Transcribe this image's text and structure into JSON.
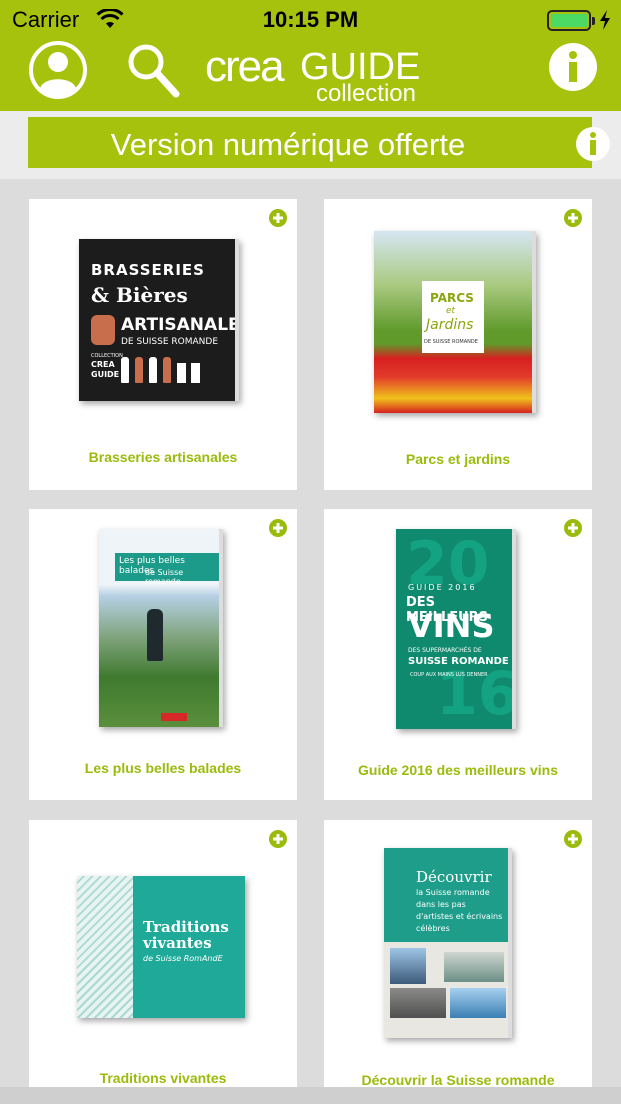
{
  "status_bar": {
    "carrier": "Carrier",
    "time": "10:15 PM"
  },
  "nav": {
    "logo_crea": "crea",
    "logo_guide": "GUIDE",
    "logo_collection": "collection",
    "icons": [
      "profile-icon",
      "search-icon",
      "info-icon"
    ]
  },
  "banner": {
    "text": "Version numérique offerte",
    "icon": "info-icon"
  },
  "colors": {
    "brand_green": "#a6c20c",
    "title_green": "#9bbb0c",
    "teal": "#0f8a6e"
  },
  "books": [
    {
      "title": "Brasseries artisanales",
      "cover": {
        "l1": "BRASSERIES",
        "l2": "& Bières",
        "l3": "ARTISANALES",
        "l4": "DE SUISSE ROMANDE",
        "l5": "COLLECTION",
        "l6": "CREA",
        "l7": "GUIDE"
      }
    },
    {
      "title": "Parcs et jardins",
      "cover": {
        "l1": "PARCS",
        "l2": "et",
        "l3": "Jardins",
        "l4": "DE SUISSE ROMANDE"
      }
    },
    {
      "title": "Les plus belles balades",
      "cover": {
        "l1": "Les plus belles balades",
        "l2": "de Suisse romande"
      }
    },
    {
      "title": "Guide 2016 des meilleurs vins",
      "cover": {
        "l1": "GUIDE 2016",
        "l2": "DES MEILLEURS",
        "l3": "VINS",
        "l4": "DES SUPERMARCHÉS DE",
        "l5": "SUISSE ROMANDE",
        "l6": "COUP AUX MAINS LUS DENNER",
        "l7": "20",
        "l8": "16"
      }
    },
    {
      "title": "Traditions vivantes",
      "cover": {
        "l1": "Traditions",
        "l2": "vivantes",
        "l3": "de Suisse RomAndE"
      }
    },
    {
      "title": "Découvrir la Suisse romande",
      "cover": {
        "l1": "Découvrir",
        "l2": "la Suisse romande",
        "l3": "dans les pas",
        "l4": "d'artistes et écrivains",
        "l5": "célèbres"
      }
    }
  ]
}
